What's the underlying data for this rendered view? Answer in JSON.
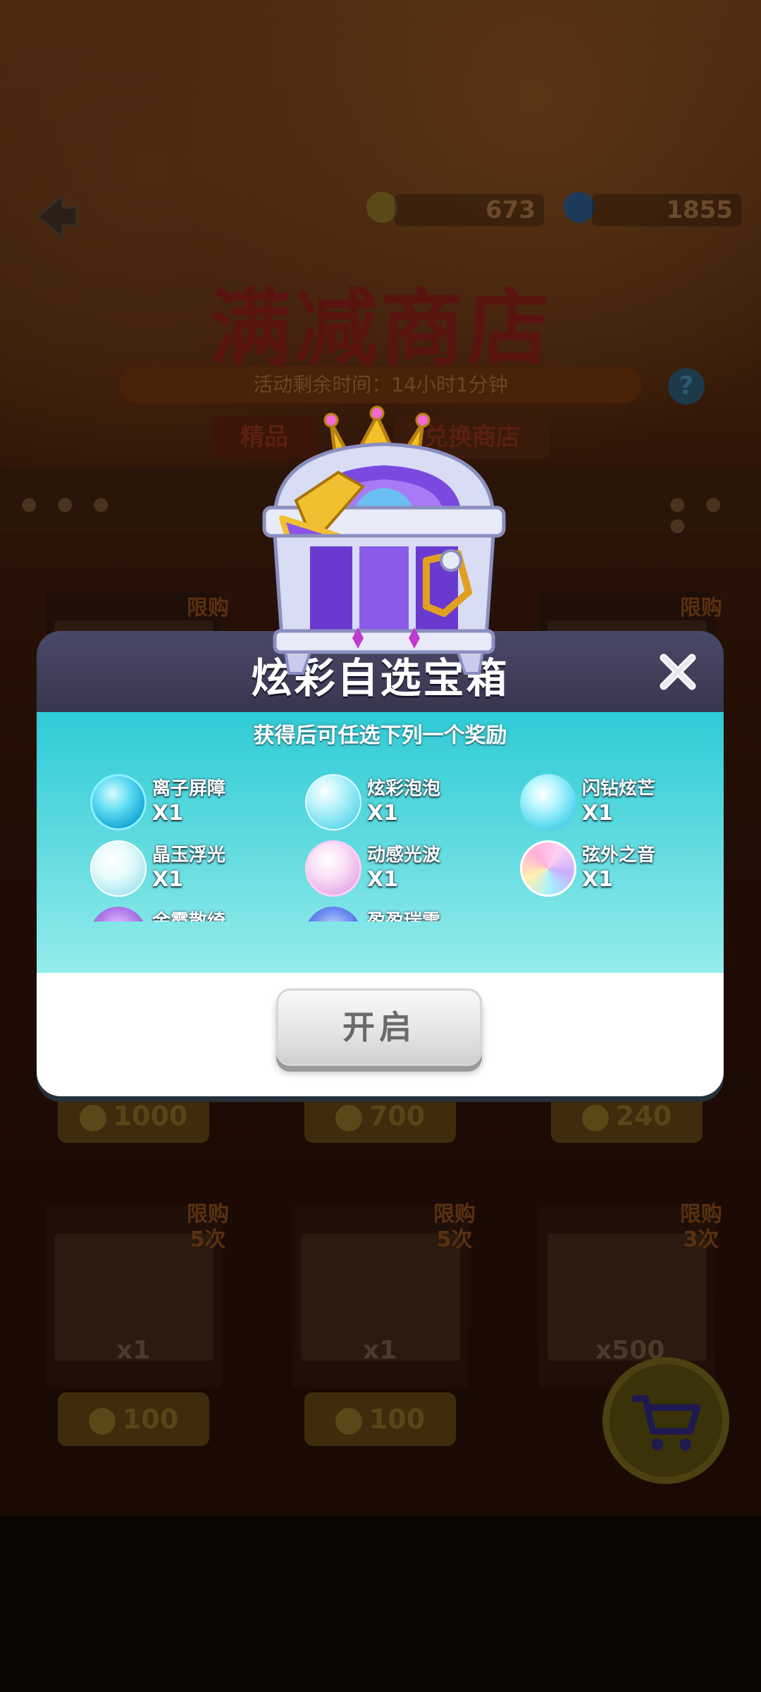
{
  "background": {
    "currencies": [
      {
        "name": "gold-coin-icon",
        "value": "673"
      },
      {
        "name": "gem-icon",
        "value": "1855"
      }
    ],
    "shop_title": "满减商店",
    "timer": "活动剩余时间：14小时1分钟",
    "tabs": [
      "精品",
      "兑换商店"
    ],
    "cards": [
      {
        "limit": "限购\n5次",
        "qty": "x1",
        "price": "100"
      },
      {
        "limit": "限购\n5次",
        "qty": "x1",
        "price": "100"
      },
      {
        "limit": "限购\n3次",
        "qty": "x500",
        "price": ""
      }
    ],
    "prices_row1": [
      "1000",
      "700",
      "240"
    ]
  },
  "modal": {
    "title": "炫彩自选宝箱",
    "subtitle": "获得后可任选下列一个奖励",
    "rewards": [
      {
        "name": "离子屏障",
        "qty": "X1",
        "color": "#2ec8e6"
      },
      {
        "name": "炫彩泡泡",
        "qty": "X1",
        "color": "#7fe0f0"
      },
      {
        "name": "闪钻炫芒",
        "qty": "X1",
        "color": "#6ad8ee"
      },
      {
        "name": "晶玉浮光",
        "qty": "X1",
        "color": "#c8f2f6"
      },
      {
        "name": "动感光波",
        "qty": "X1",
        "color": "#f3c8f0"
      },
      {
        "name": "弦外之音",
        "qty": "X1",
        "color": "#e0b8f0"
      },
      {
        "name": "余霞散绮",
        "qty": "",
        "color": "#b87ae8"
      },
      {
        "name": "盈盈瑞雪",
        "qty": "",
        "color": "#5a7ae8"
      }
    ],
    "open_label": "开启"
  }
}
